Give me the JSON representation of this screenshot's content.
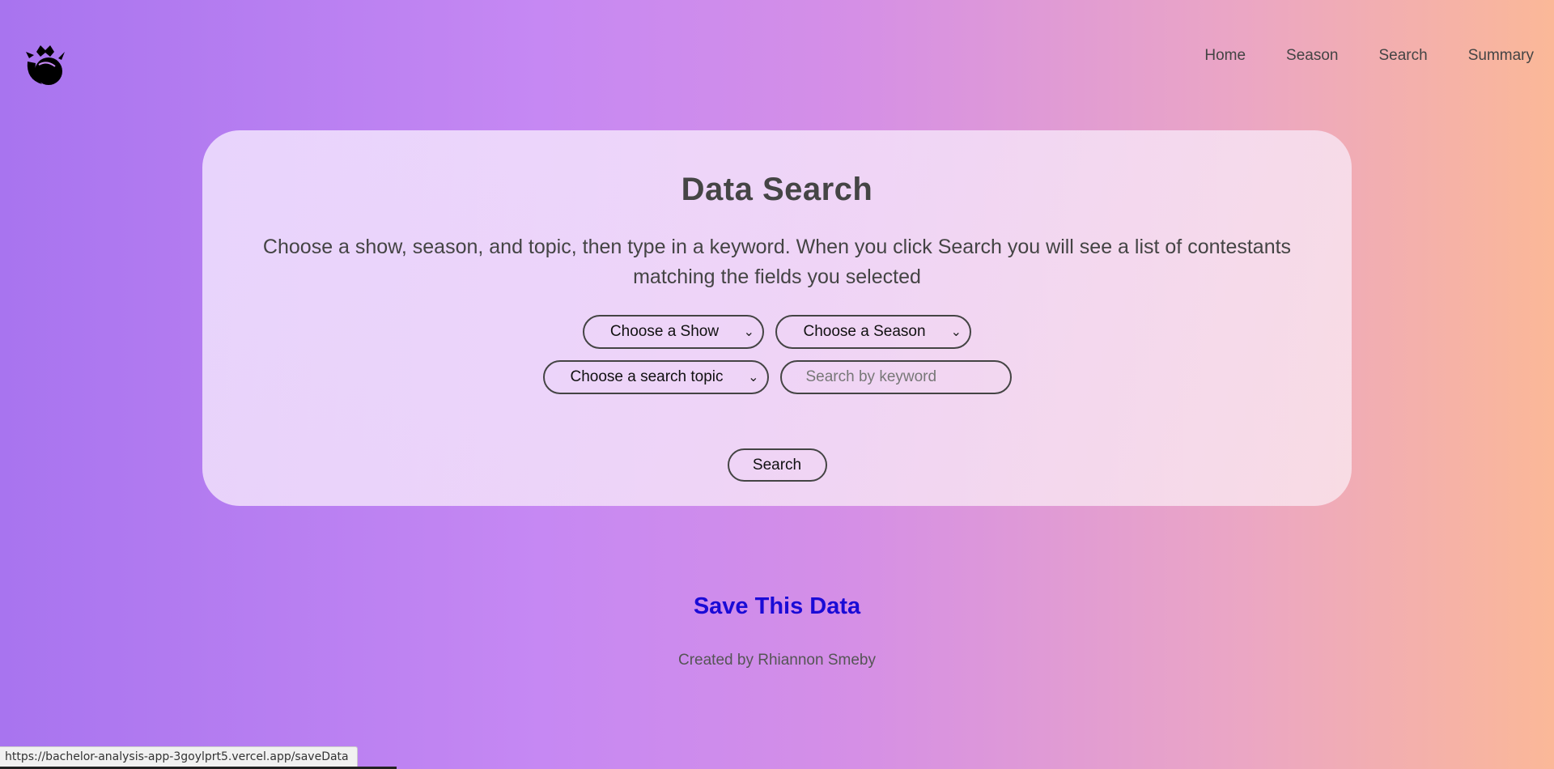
{
  "header": {
    "logo_icon": "rose-icon",
    "nav": [
      {
        "label": "Home"
      },
      {
        "label": "Season"
      },
      {
        "label": "Search"
      },
      {
        "label": "Summary"
      }
    ]
  },
  "card": {
    "title": "Data Search",
    "description": "Choose a show, season, and topic, then type in a keyword. When you click Search you will see a list of contestants matching the fields you selected",
    "show_select": "Choose a Show",
    "season_select": "Choose a Season",
    "topic_select": "Choose a search topic",
    "keyword_placeholder": "Search by keyword",
    "search_button": "Search"
  },
  "save_link": "Save This Data",
  "credit": "Created by Rhiannon Smeby",
  "status_url": "https://bachelor-analysis-app-3goylprt5.vercel.app/saveData",
  "colors": {
    "link": "#1a0bd6",
    "gradient_start": "#a874ef",
    "gradient_end": "#fbb898"
  }
}
